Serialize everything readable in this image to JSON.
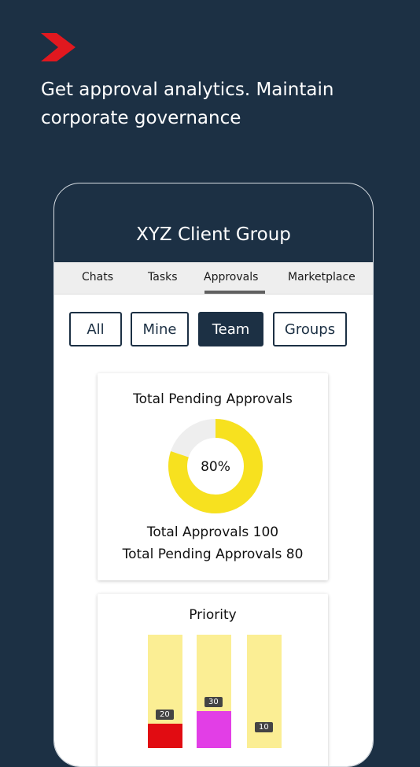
{
  "headline": "Get approval analytics. Maintain corporate governance",
  "colors": {
    "background": "#1c3044",
    "brand": "#e1181f",
    "donut": "#f7e11f",
    "donut_track": "#eeeeee",
    "bar_track": "#fbee94"
  },
  "app": {
    "group_title": "XYZ Client Group"
  },
  "tabs": [
    {
      "label": "Chats"
    },
    {
      "label": "Tasks"
    },
    {
      "label": "Approvals"
    },
    {
      "label": "Marketplace"
    }
  ],
  "active_tab": "Approvals",
  "filters": [
    {
      "label": "All"
    },
    {
      "label": "Mine"
    },
    {
      "label": "Team"
    },
    {
      "label": "Groups"
    }
  ],
  "active_filter": "Team",
  "pending_card": {
    "title": "Total Pending Approvals",
    "percent_label": "80%",
    "percent": 80,
    "total_line": "Total Approvals  100",
    "pending_line": "Total Pending Approvals 80"
  },
  "priority_card": {
    "title": "Priority"
  },
  "chart_data": {
    "type": "bar",
    "title": "Priority",
    "categories": [
      "",
      "",
      ""
    ],
    "values": [
      20,
      30,
      10
    ],
    "colors": [
      "#e10c12",
      "#e23ee6",
      "#fbee94"
    ]
  }
}
